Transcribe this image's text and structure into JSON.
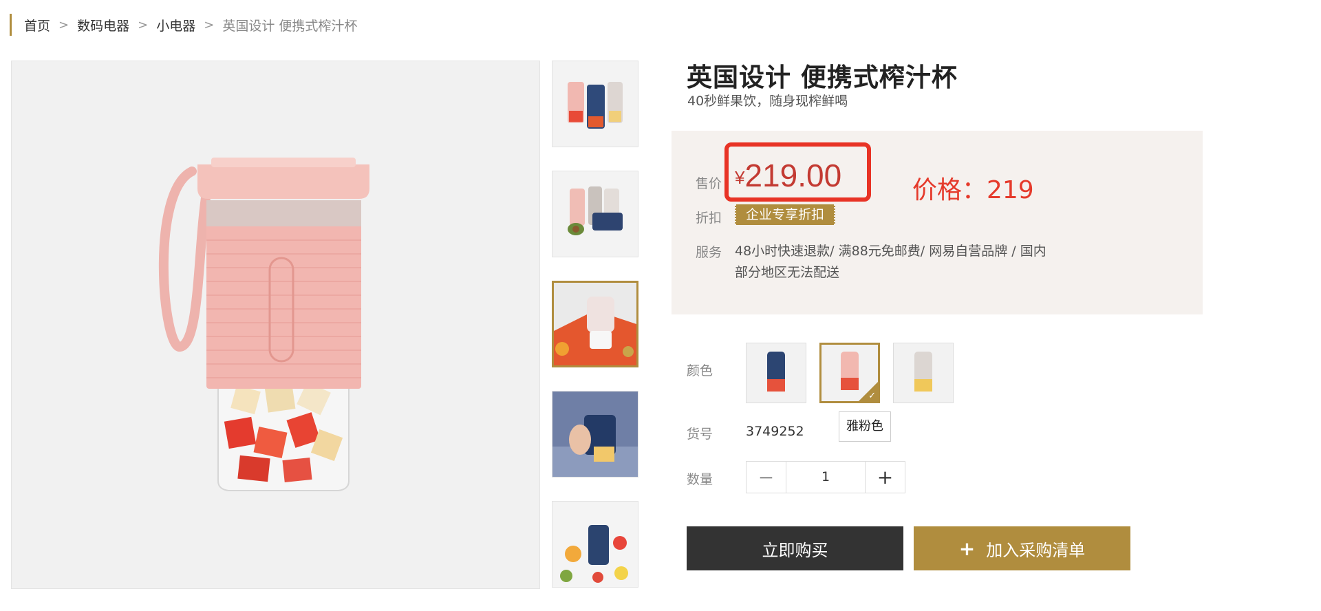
{
  "breadcrumb": {
    "items": [
      "首页",
      "数码电器",
      "小电器",
      "英国设计 便携式榨汁杯"
    ],
    "separator": ">"
  },
  "product": {
    "title": "英国设计 便携式榨汁杯",
    "subtitle": "40秒鲜果饮，随身现榨鲜喝"
  },
  "price_box": {
    "price_label": "售价",
    "currency": "¥",
    "price": "219.00",
    "discount_label": "折扣",
    "discount_badge": "企业专享折扣",
    "service_label": "服务",
    "service_text": "48小时快速退款/ 满88元免邮费/ 网易自营品牌 / 国内部分地区无法配送"
  },
  "annotation": {
    "text": "价格：219",
    "color": "#e53a2b"
  },
  "options": {
    "color_label": "颜色",
    "colors": [
      "navy",
      "pink",
      "white"
    ],
    "selected_color": "雅粉色",
    "sku_label": "货号",
    "sku": "3749252",
    "qty_label": "数量",
    "qty": "1",
    "minus": "−",
    "plus": "+"
  },
  "actions": {
    "buy_now": "立即购买",
    "add_to_list": "加入采购清单",
    "add_icon": "+"
  },
  "theme": {
    "accent": "#b08d3e",
    "price_color": "#c33a32",
    "dark_button": "#333333",
    "price_box_bg": "#f5f1ee"
  }
}
